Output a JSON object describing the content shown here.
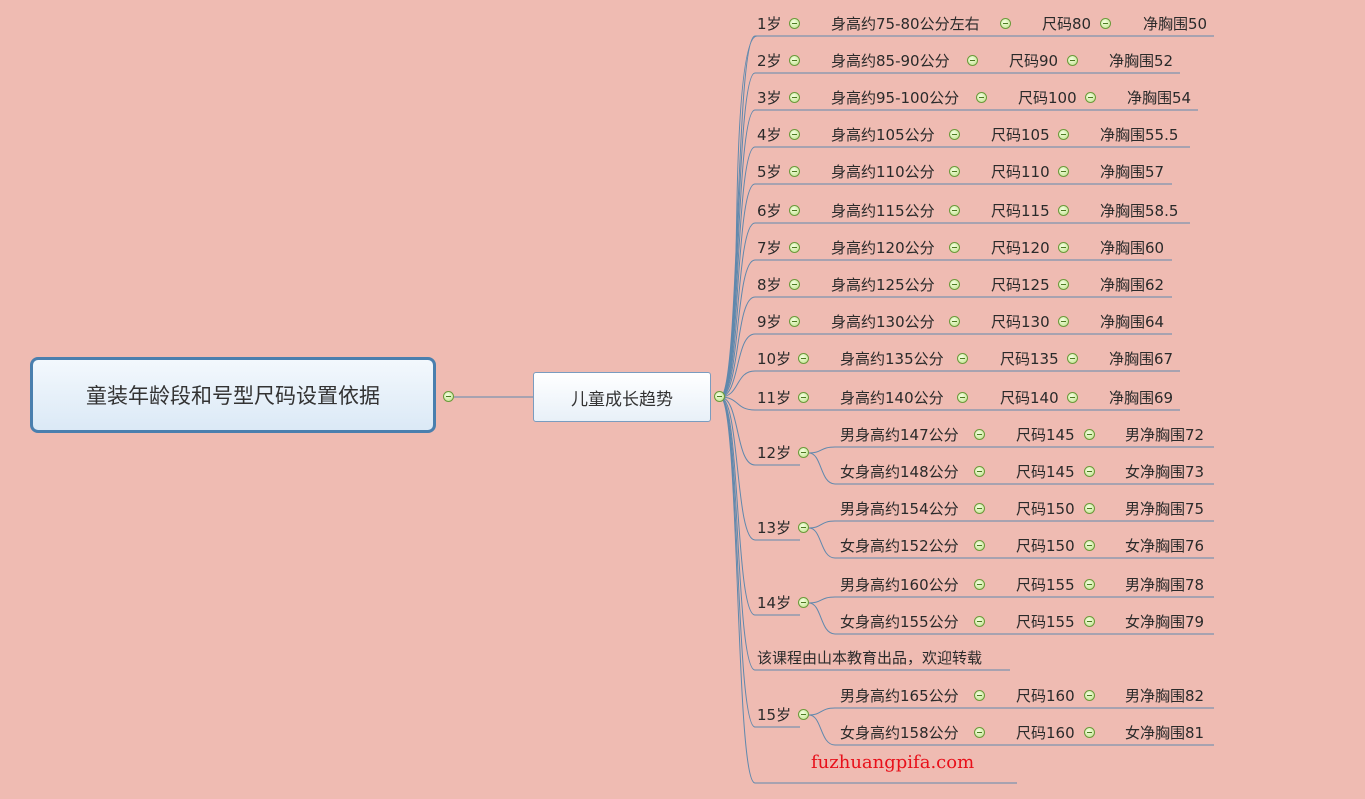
{
  "root": {
    "label": "童装年龄段和号型尺码设置依据"
  },
  "center": {
    "label": "儿童成长趋势"
  },
  "rows": [
    {
      "age": "1岁",
      "height": "身高约75-80公分左右",
      "size": "尺码80",
      "chest": "净胸围50"
    },
    {
      "age": "2岁",
      "height": "身高约85-90公分",
      "size": "尺码90",
      "chest": "净胸围52"
    },
    {
      "age": "3岁",
      "height": "身高约95-100公分",
      "size": "尺码100",
      "chest": "净胸围54"
    },
    {
      "age": "4岁",
      "height": "身高约105公分",
      "size": "尺码105",
      "chest": "净胸围55.5"
    },
    {
      "age": "5岁",
      "height": "身高约110公分",
      "size": "尺码110",
      "chest": "净胸围57"
    },
    {
      "age": "6岁",
      "height": "身高约115公分",
      "size": "尺码115",
      "chest": "净胸围58.5"
    },
    {
      "age": "7岁",
      "height": "身高约120公分",
      "size": "尺码120",
      "chest": "净胸围60"
    },
    {
      "age": "8岁",
      "height": "身高约125公分",
      "size": "尺码125",
      "chest": "净胸围62"
    },
    {
      "age": "9岁",
      "height": "身高约130公分",
      "size": "尺码130",
      "chest": "净胸围64"
    },
    {
      "age": "10岁",
      "height": "身高约135公分",
      "size": "尺码135",
      "chest": "净胸围67"
    },
    {
      "age": "11岁",
      "height": "身高约140公分",
      "size": "尺码140",
      "chest": "净胸围69"
    }
  ],
  "groups": [
    {
      "age": "12岁",
      "rows": [
        {
          "height": "男身高约147公分",
          "size": "尺码145",
          "chest": "男净胸围72"
        },
        {
          "height": "女身高约148公分",
          "size": "尺码145",
          "chest": "女净胸围73"
        }
      ]
    },
    {
      "age": "13岁",
      "rows": [
        {
          "height": "男身高约154公分",
          "size": "尺码150",
          "chest": "男净胸围75"
        },
        {
          "height": "女身高约152公分",
          "size": "尺码150",
          "chest": "女净胸围76"
        }
      ]
    },
    {
      "age": "14岁",
      "rows": [
        {
          "height": "男身高约160公分",
          "size": "尺码155",
          "chest": "男净胸围78"
        },
        {
          "height": "女身高约155公分",
          "size": "尺码155",
          "chest": "女净胸围79"
        }
      ]
    },
    {
      "age": "15岁",
      "rows": [
        {
          "height": "男身高约165公分",
          "size": "尺码160",
          "chest": "男净胸围82"
        },
        {
          "height": "女身高约158公分",
          "size": "尺码160",
          "chest": "女净胸围81"
        }
      ]
    }
  ],
  "note": "该课程由山本教育出品，欢迎转载",
  "watermark": "fuzhuangpifa.com",
  "colors": {
    "background": "#efbbb2",
    "line": "#5f88ad",
    "root_border": "#4a7fae",
    "watermark": "#e8101a"
  }
}
